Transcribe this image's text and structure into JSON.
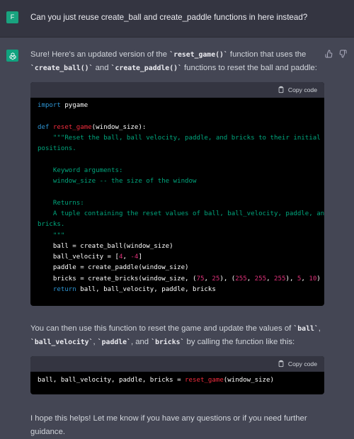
{
  "user": {
    "avatar_letter": "F",
    "message": "Can you just reuse create_ball and create_paddle functions in here instead?"
  },
  "assistant": {
    "intro_1": "Sure! Here's an updated version of the ",
    "intro_code_1": "`reset_game()`",
    "intro_2": " function that uses the",
    "intro_code_2": "`create_ball()`",
    "intro_3": " and ",
    "intro_code_3": "`create_paddle()`",
    "intro_4": " functions to reset the ball and paddle:",
    "copy_label": "Copy code",
    "after_1": "You can then use this function to reset the game and update the values of ",
    "after_code_1": "`ball`",
    "after_2": ",",
    "after_code_2": "`ball_velocity`",
    "after_3": ", ",
    "after_code_3": "`paddle`",
    "after_4": ", and ",
    "after_code_4": "`bricks`",
    "after_5": " by calling the function like this:",
    "closing": "I hope this helps! Let me know if you have any questions or if you need further guidance."
  },
  "code1": {
    "l1_kw": "import",
    "l1_rest": " pygame",
    "l3_kw": "def",
    "l3_fn": "reset_game",
    "l3_rest": "(window_size):",
    "l4": "    \"\"\"Reset the ball, ball velocity, paddle, and bricks to their initial",
    "l5": "positions.",
    "l7": "    Keyword arguments:",
    "l8": "    window_size -- the size of the window",
    "l10": "    Returns:",
    "l11": "    A tuple containing the reset values of ball, ball_velocity, paddle, and",
    "l12": "bricks.",
    "l13": "    \"\"\"",
    "l14": "    ball = create_ball(window_size)",
    "l15_a": "    ball_velocity = [",
    "l15_n1": "4",
    "l15_b": ", ",
    "l15_n2": "-4",
    "l15_c": "]",
    "l16": "    paddle = create_paddle(window_size)",
    "l17_a": "    bricks = create_bricks(window_size, (",
    "l17_n1": "75",
    "l17_s1": ", ",
    "l17_n2": "25",
    "l17_s2": "), (",
    "l17_n3": "255",
    "l17_s3": ", ",
    "l17_n4": "255",
    "l17_s4": ", ",
    "l17_n5": "255",
    "l17_s5": "), ",
    "l17_n6": "5",
    "l17_s6": ", ",
    "l17_n7": "10",
    "l17_s7": ")",
    "l18_kw": "return",
    "l18_rest": " ball, ball_velocity, paddle, bricks"
  },
  "code2": {
    "a": "ball, ball_velocity, paddle, bricks = ",
    "fn": "reset_game",
    "b": "(window_size)"
  }
}
